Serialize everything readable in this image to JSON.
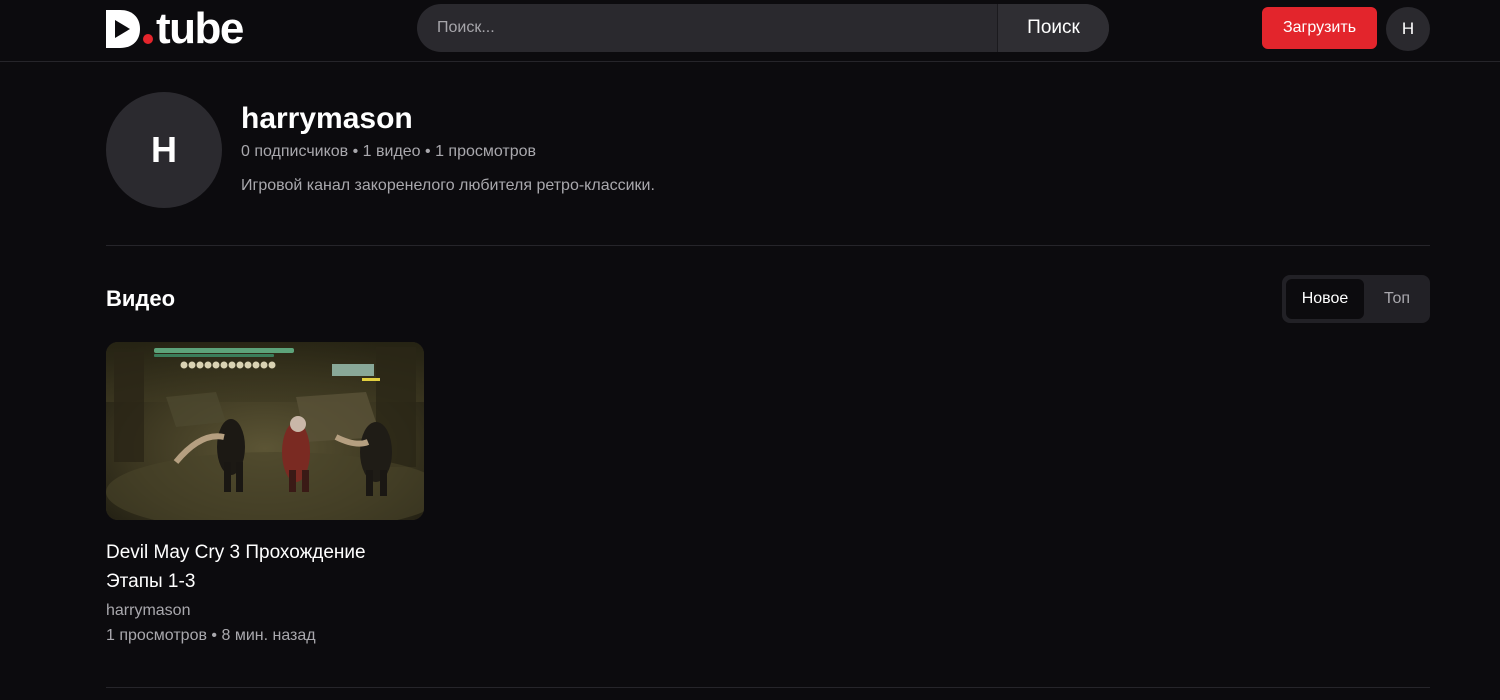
{
  "header": {
    "logo_text": "tube",
    "search_placeholder": "Поиск...",
    "search_button_label": "Поиск",
    "upload_button_label": "Загрузить",
    "user_initial": "H"
  },
  "channel": {
    "avatar_initial": "H",
    "name": "harrymason",
    "stats": "0 подписчиков • 1 видео • 1 просмотров",
    "description": "Игровой канал закоренелого любителя ретро-классики."
  },
  "videos_section": {
    "title": "Видео",
    "sort_options": [
      {
        "label": "Новое",
        "active": true
      },
      {
        "label": "Топ",
        "active": false
      }
    ],
    "items": [
      {
        "title": "Devil May Cry 3 Прохождение Этапы 1-3",
        "channel": "harrymason",
        "meta": "1 просмотров • 8 мин. назад",
        "thumbnail_icon": "game-screenshot"
      }
    ]
  },
  "colors": {
    "background": "#0c0b0e",
    "accent": "#e3252c",
    "surface": "#2a292e",
    "muted_text": "#a9a8ad",
    "divider": "#26252a"
  }
}
